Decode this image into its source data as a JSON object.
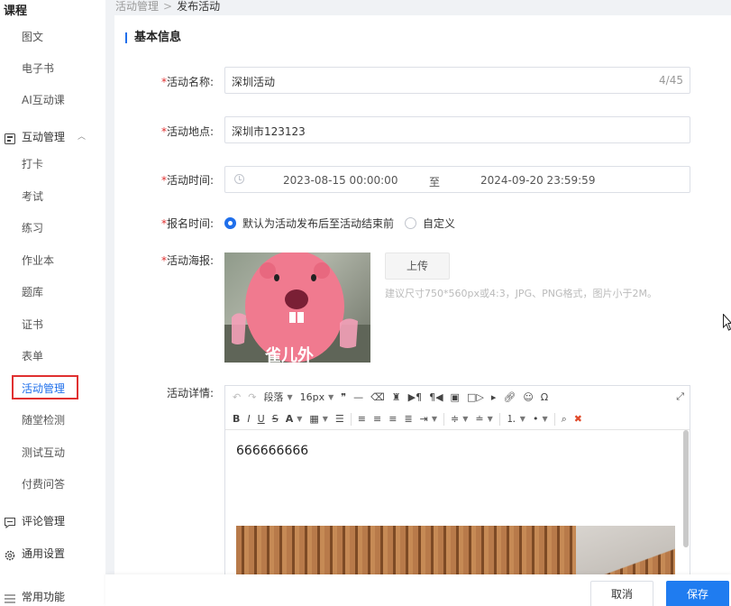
{
  "sidebar": {
    "title": "课程",
    "course_items": [
      "图文",
      "电子书",
      "AI互动课"
    ],
    "interaction_group": "互动管理",
    "interaction_items": [
      "打卡",
      "考试",
      "练习",
      "作业本",
      "题库",
      "证书",
      "表单",
      "活动管理",
      "随堂检测",
      "测试互动",
      "付费问答"
    ],
    "active_item": "活动管理",
    "comment_group": "评论管理",
    "settings_group": "通用设置",
    "common_group": "常用功能"
  },
  "breadcrumb": {
    "parent": "活动管理",
    "separator": ">",
    "current": "发布活动"
  },
  "form": {
    "section_title": "基本信息",
    "required_mark": "*",
    "name": {
      "label": "活动名称:",
      "value": "深圳活动",
      "count": "4/45"
    },
    "location": {
      "label": "活动地点:",
      "value": "深圳市123123"
    },
    "time": {
      "label": "活动时间:",
      "start": "2023-08-15 00:00:00",
      "separator": "至",
      "end": "2024-09-20 23:59:59"
    },
    "signup": {
      "label": "报名时间:",
      "option_default": "默认为活动发布后至活动结束前",
      "option_custom": "自定义",
      "selected": "default"
    },
    "poster": {
      "label": "活动海报:",
      "upload_label": "上传",
      "hint": "建议尺寸750*560px或4:3，JPG、PNG格式，图片小于2M。",
      "image_caption": "雀儿外"
    },
    "details": {
      "label": "活动详情:",
      "toolbar": {
        "paragraph": "段落",
        "font_size": "16px"
      },
      "content": "666666666"
    }
  },
  "footer": {
    "cancel_label": "取消",
    "save_label": "保存"
  },
  "colors": {
    "accent": "#1f7cf0",
    "required": "#e03030",
    "active_outline": "#e03030"
  }
}
